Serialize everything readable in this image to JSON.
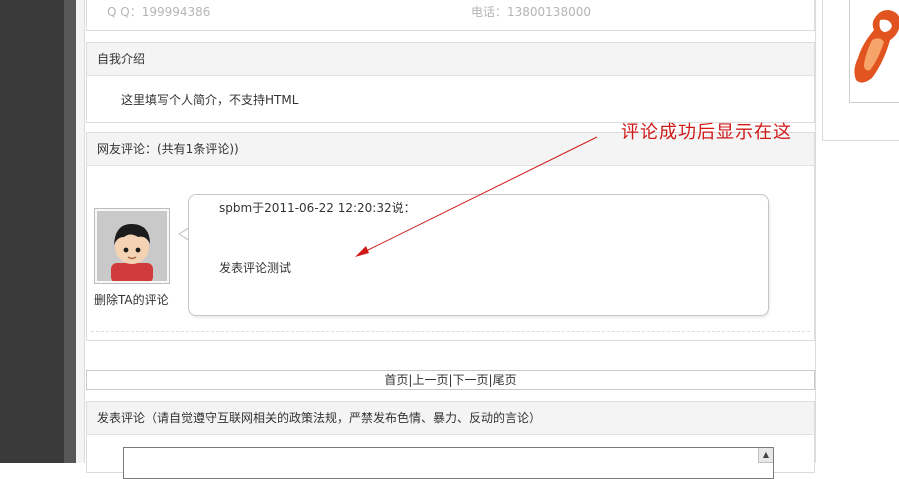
{
  "contact": {
    "qq": "Q Q：199994386",
    "phone": "电话：13800138000"
  },
  "intro": {
    "heading": "自我介绍",
    "text": "这里填写个人简介，不支持HTML"
  },
  "comments": {
    "heading": "网友评论：(共有1条评论))",
    "items": [
      {
        "meta": "spbm于2011-06-22 12:20:32说：",
        "body": "发表评论测试",
        "delete_label": "删除TA的评论"
      }
    ]
  },
  "annotation": {
    "text": "评论成功后显示在这",
    "color": "#d01818"
  },
  "pager": {
    "first": "首页",
    "prev": "上一页",
    "next": "下一页",
    "last": "尾页",
    "separator": "|"
  },
  "post": {
    "heading": "发表评论（请自觉遵守互联网相关的政策法规，严禁发布色情、暴力、反动的言论）",
    "textarea_value": ""
  },
  "icons": {
    "logo": "brand-logo-icon",
    "avatar": "user-avatar-icon",
    "scroll": "scroll-up-arrow-icon"
  }
}
